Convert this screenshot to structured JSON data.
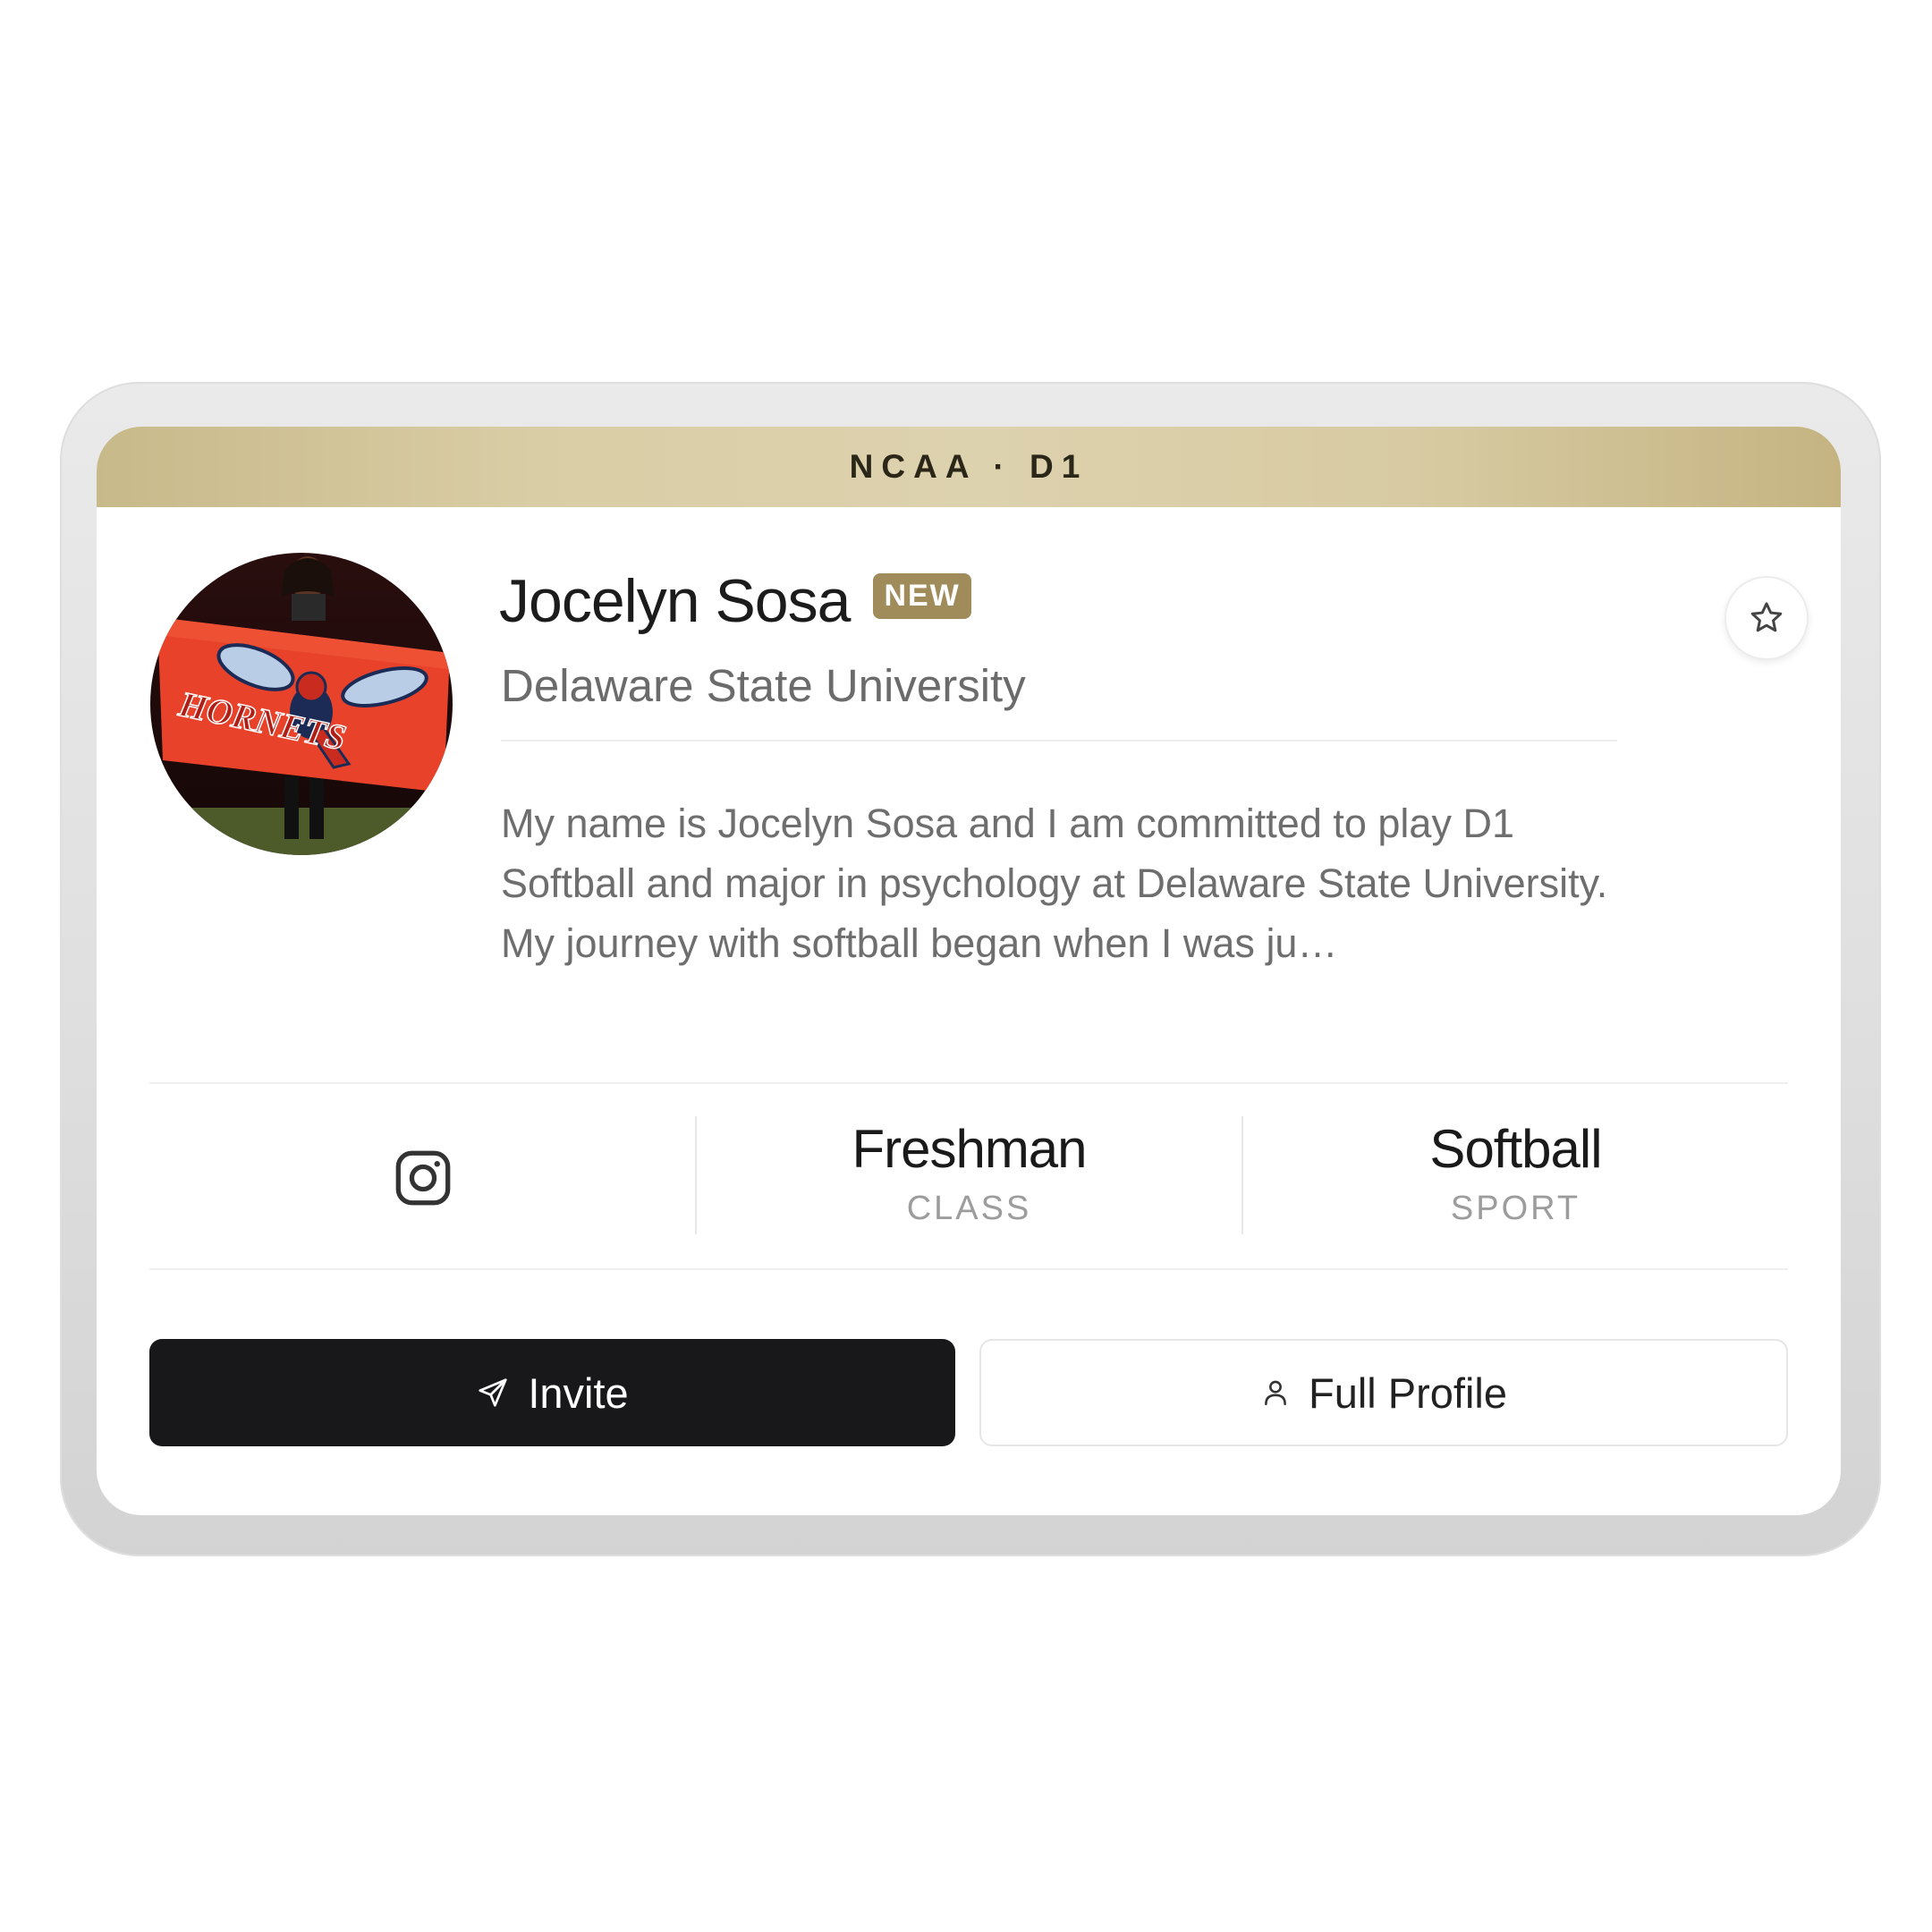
{
  "banner": {
    "label": "NCAA · D1"
  },
  "athlete": {
    "name": "Jocelyn Sosa",
    "badge": "NEW",
    "school": "Delaware State University",
    "bio": "My name is Jocelyn Sosa and I am committed to play D1 Softball and major in psychology at Delaware State University. My journey with softball began when I was ju…",
    "avatar_alt": "Athlete holding a red Delaware State Hornets flag"
  },
  "stats": {
    "social": {
      "icon": "instagram-icon"
    },
    "class": {
      "value": "Freshman",
      "label": "CLASS"
    },
    "sport": {
      "value": "Softball",
      "label": "SPORT"
    }
  },
  "actions": {
    "favorite": {
      "icon": "star-icon"
    },
    "invite": {
      "label": "Invite",
      "icon": "send-icon"
    },
    "full_profile": {
      "label": "Full Profile",
      "icon": "user-icon"
    }
  },
  "colors": {
    "banner_gold": "#d9cda5",
    "badge_gold": "#a08c5b",
    "invite_bg": "#18181a"
  }
}
